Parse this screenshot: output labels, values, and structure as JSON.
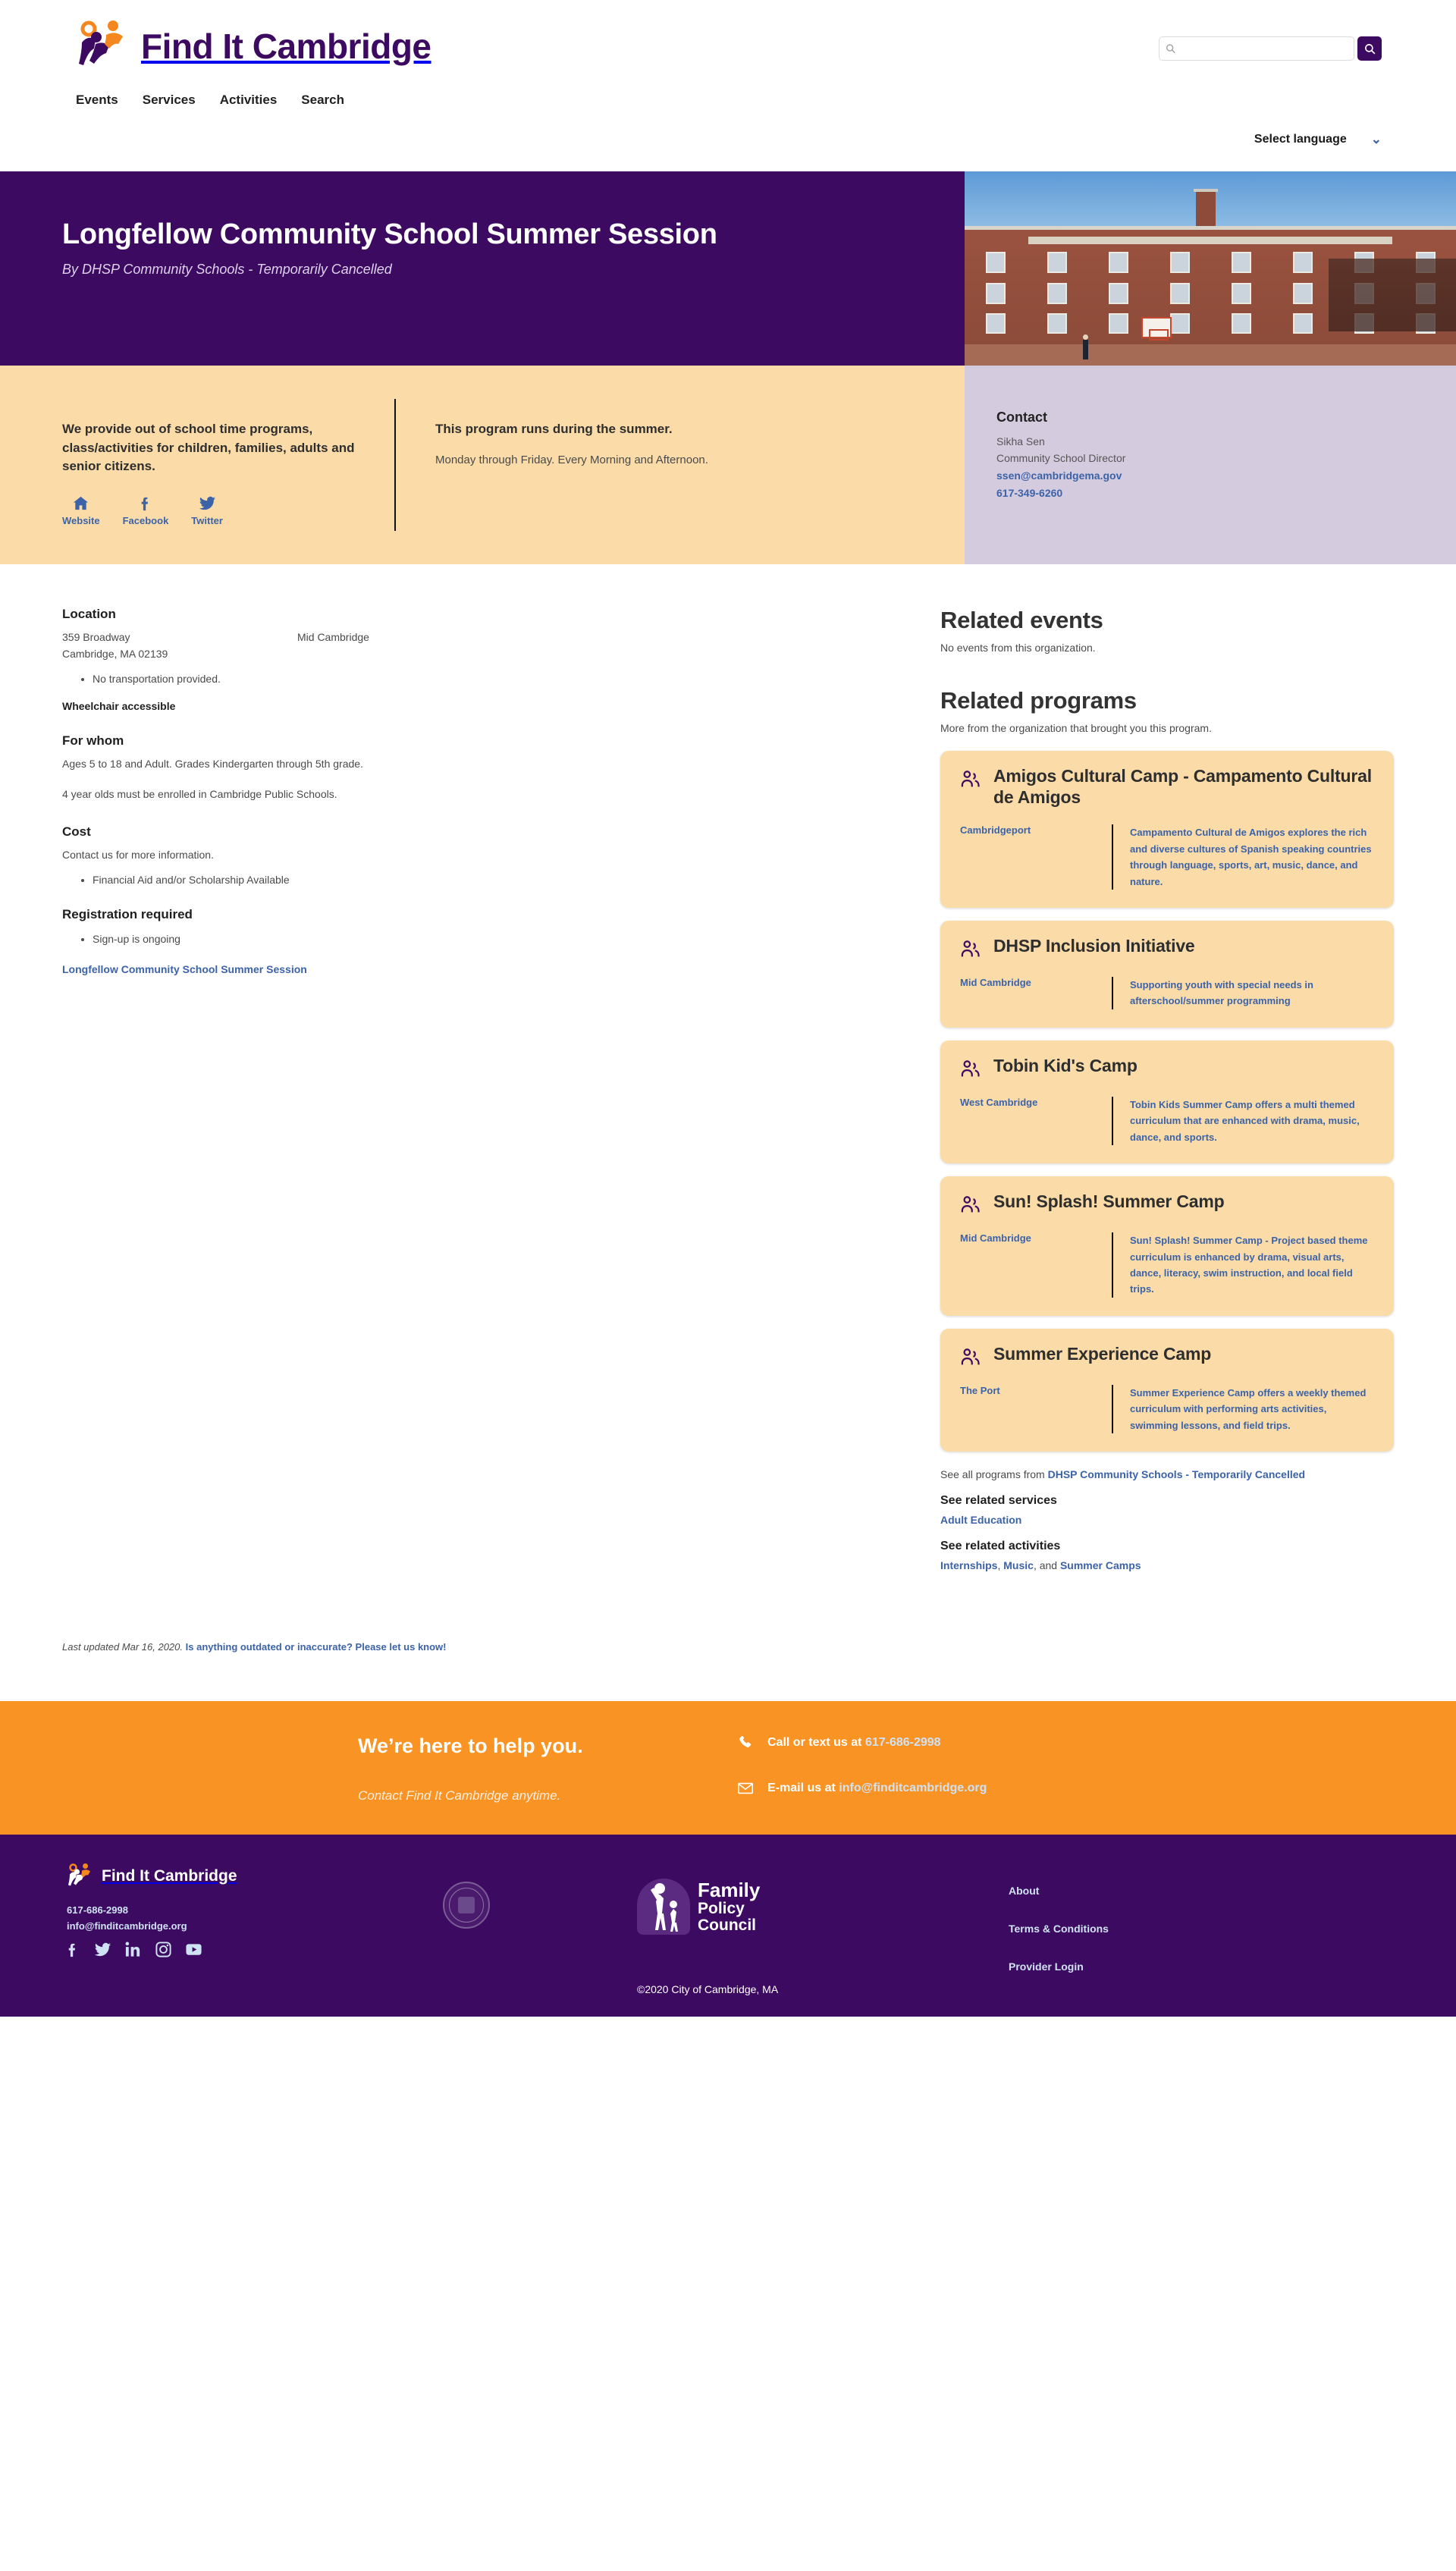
{
  "header": {
    "brand_name": "Find It Cambridge",
    "nav": [
      {
        "label": "Events"
      },
      {
        "label": "Services"
      },
      {
        "label": "Activities"
      },
      {
        "label": "Search"
      }
    ],
    "search": {
      "placeholder": "",
      "value": "",
      "icon": "search-icon"
    },
    "language": {
      "label": "Select language",
      "chevron": "chevron-down-icon"
    }
  },
  "hero": {
    "title": "Longfellow Community School Summer Session",
    "byline": "By DHSP Community Schools - Temporarily Cancelled",
    "image_alt": "Henry Wadsworth Longfellow School brick building"
  },
  "stripe": {
    "about": "We provide out of school time programs, class/activities for children, families, adults and senior citizens.",
    "socials": [
      {
        "label": "Website",
        "icon": "home-icon"
      },
      {
        "label": "Facebook",
        "icon": "facebook-icon"
      },
      {
        "label": "Twitter",
        "icon": "twitter-icon"
      }
    ],
    "schedule_heading": "This program runs during the summer.",
    "schedule_detail": "Monday through Friday. Every Morning and Afternoon.",
    "contact": {
      "heading": "Contact",
      "name": "Sikha Sen",
      "role": "Community School Director",
      "email": "ssen@cambridgema.gov",
      "phone": "617-349-6260"
    }
  },
  "details": {
    "location_heading": "Location",
    "address_line1": "359 Broadway",
    "address_line2": "Cambridge, MA 02139",
    "neighborhood": "Mid Cambridge",
    "transport_note": "No transportation provided.",
    "accessibility": "Wheelchair accessible",
    "forwhom_heading": "For whom",
    "forwhom_line1": "Ages 5 to 18 and Adult. Grades Kindergarten through 5th grade.",
    "forwhom_line2": "4 year olds must be enrolled in Cambridge Public Schools.",
    "cost_heading": "Cost",
    "cost_line": "Contact us for more information.",
    "cost_bullet": "Financial Aid and/or Scholarship Available",
    "registration_heading": "Registration required",
    "registration_bullet": "Sign-up is ongoing",
    "registration_link": "Longfellow Community School Summer Session"
  },
  "related": {
    "events_heading": "Related events",
    "events_empty": "No events from this organization.",
    "programs_heading": "Related programs",
    "programs_sub": "More from the organization that brought you this program.",
    "programs": [
      {
        "icon": "people-icon",
        "title": "Amigos Cultural Camp - Campamento Cultural de Amigos",
        "location": "Cambridgeport",
        "description": "Campamento Cultural de Amigos explores the rich and diverse cultures of Spanish speaking countries through language, sports, art, music, dance, and nature."
      },
      {
        "icon": "people-icon",
        "title": "DHSP Inclusion Initiative",
        "location": "Mid Cambridge",
        "description": "Supporting youth with special needs in afterschool/summer programming"
      },
      {
        "icon": "people-icon",
        "title": "Tobin Kid's Camp",
        "location": "West Cambridge",
        "description": "Tobin Kids Summer Camp offers a multi themed curriculum that are enhanced with drama, music, dance, and sports."
      },
      {
        "icon": "people-icon",
        "title": "Sun! Splash! Summer Camp",
        "location": "Mid Cambridge",
        "description": "Sun! Splash! Summer Camp - Project based theme curriculum is enhanced by drama, visual arts, dance, literacy, swim instruction, and local field trips."
      },
      {
        "icon": "people-icon",
        "title": "Summer Experience Camp",
        "location": "The Port",
        "description": "Summer Experience Camp offers a weekly themed curriculum with performing arts activities, swimming lessons, and field trips."
      }
    ],
    "see_all_prefix": "See all programs from",
    "see_all_org": "DHSP Community Schools - Temporarily Cancelled",
    "services_heading": "See related services",
    "services": [
      "Adult Education"
    ],
    "activities_heading": "See related activities",
    "activities": [
      "Internships",
      "Music",
      "Summer Camps"
    ],
    "activities_joiner": ", and "
  },
  "updated": {
    "text": "Last updated Mar 16, 2020.",
    "link": "Is anything outdated or inaccurate? Please let us know!"
  },
  "help": {
    "heading": "We’re here to help you.",
    "sub": "Contact Find It Cambridge anytime.",
    "phone_prefix": "Call or text us at",
    "phone": "617-686-2998",
    "email_prefix": "E-mail us at",
    "email": "info@finditcambridge.org",
    "phone_icon": "phone-icon",
    "email_icon": "envelope-icon"
  },
  "footer": {
    "brand_name": "Find It Cambridge",
    "phone": "617-686-2998",
    "email": "info@finditcambridge.org",
    "socials": [
      {
        "icon": "facebook-icon"
      },
      {
        "icon": "twitter-icon"
      },
      {
        "icon": "linkedin-icon"
      },
      {
        "icon": "instagram-icon"
      },
      {
        "icon": "youtube-icon"
      }
    ],
    "seal_alt": "City of Cambridge seal",
    "fpc_line1": "Family",
    "fpc_line2": "Policy",
    "fpc_line3": "Council",
    "links": [
      {
        "label": "About"
      },
      {
        "label": "Terms & Conditions"
      },
      {
        "label": "Provider Login"
      }
    ],
    "copyright": "©2020 City of Cambridge, MA"
  },
  "colors": {
    "purple": "#3d0a61",
    "orange": "#f99424",
    "peach": "#fbdca8",
    "lavender": "#d5cbdf",
    "link_blue": "#3c63a8"
  }
}
